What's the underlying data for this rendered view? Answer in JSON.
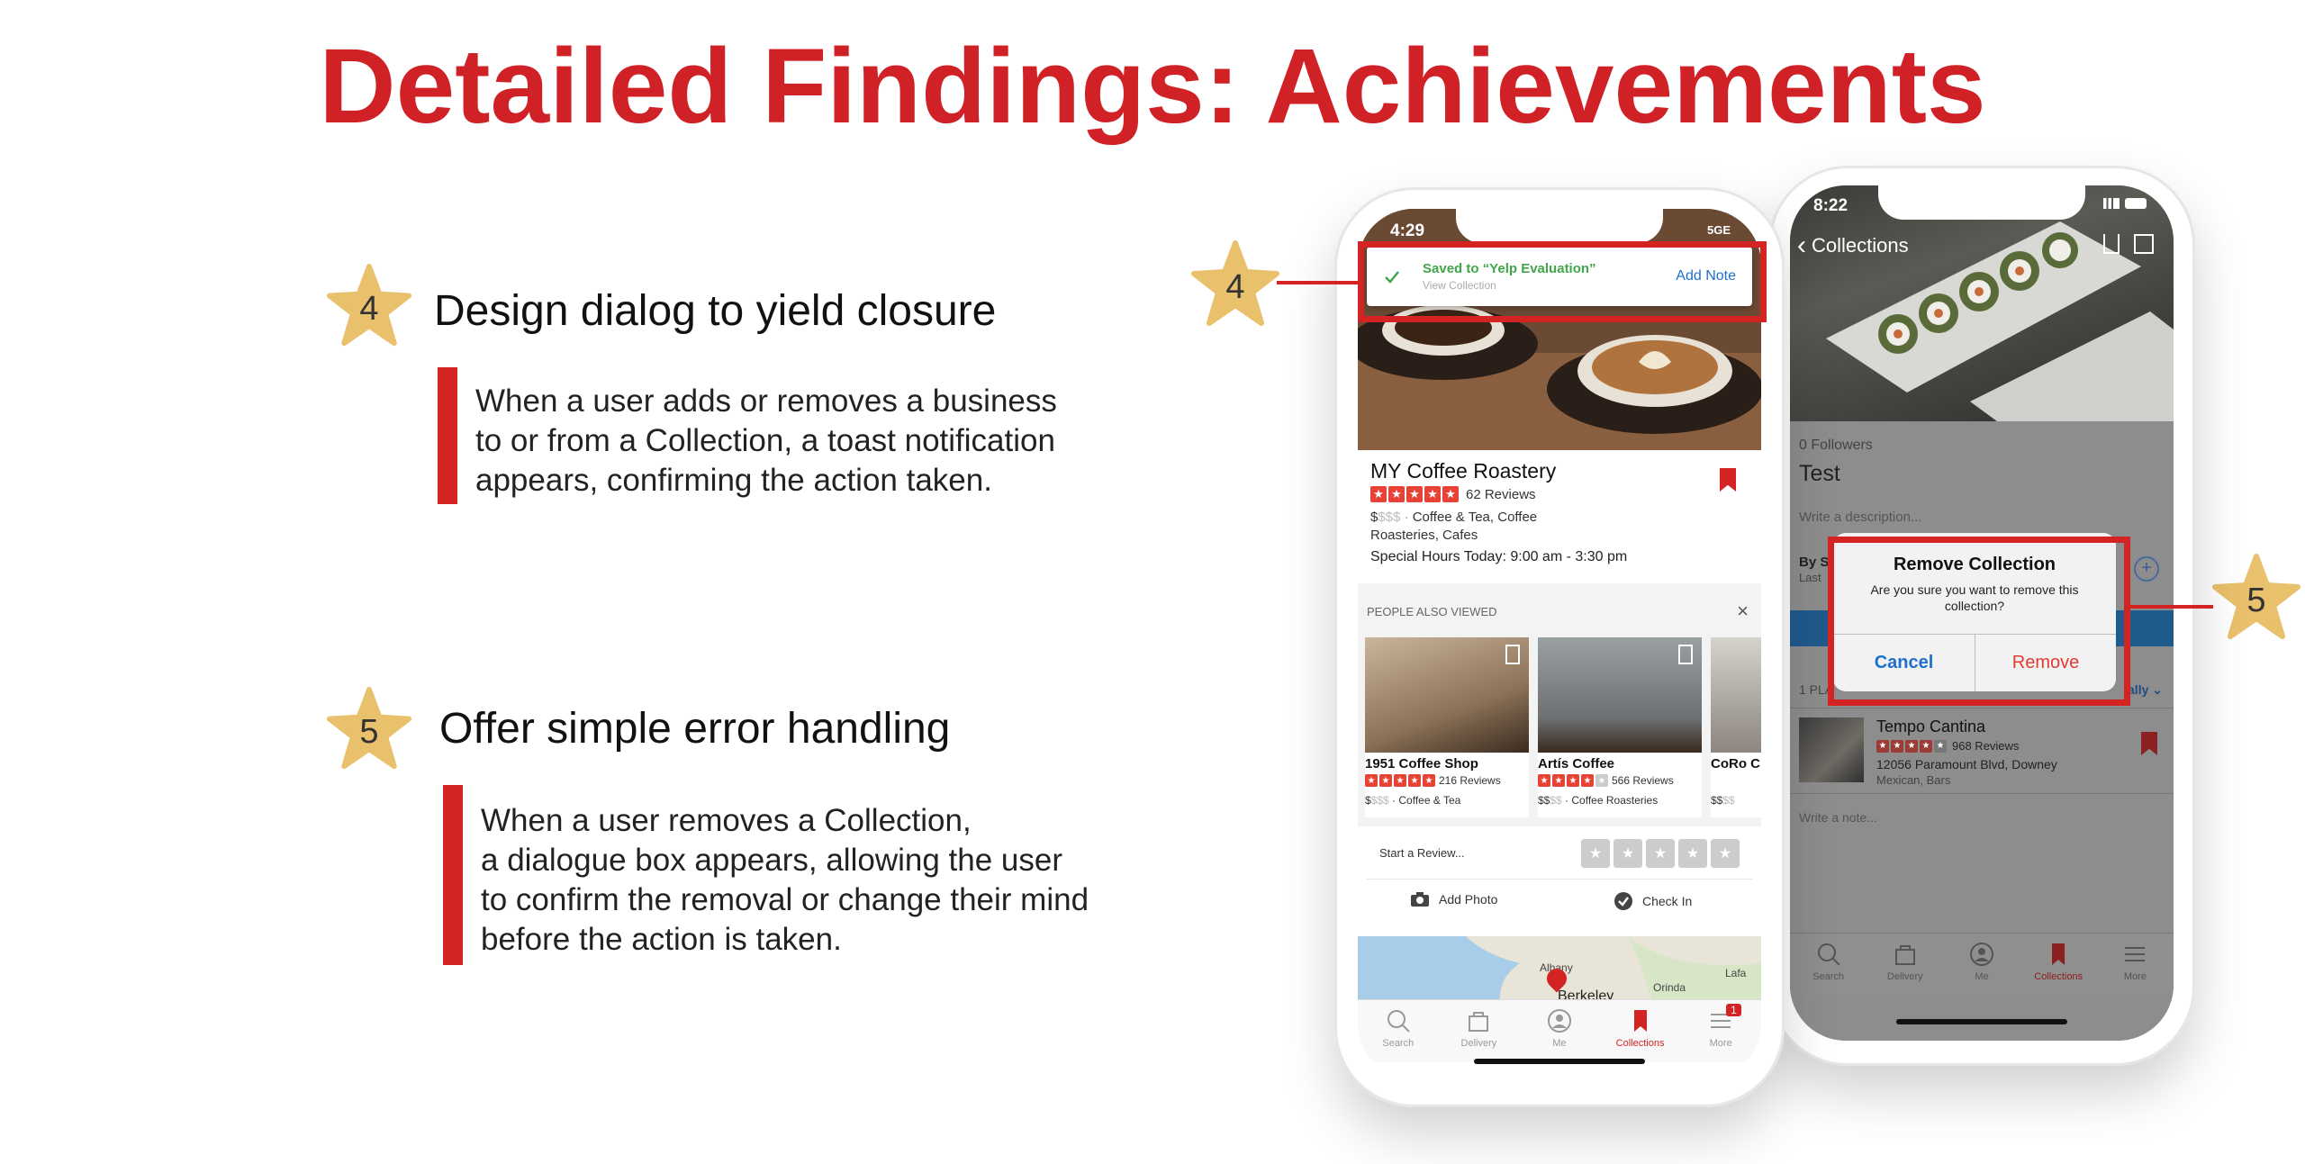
{
  "slide": {
    "title": "Detailed Findings: Achievements",
    "findings": [
      {
        "number": "4",
        "heading": "Design dialog to yield closure",
        "lines": [
          "When a user adds or removes a business",
          "to or from a Collection, a toast notification",
          "appears, confirming the action taken."
        ]
      },
      {
        "number": "5",
        "heading": "Offer simple error handling",
        "lines": [
          "When a user removes a Collection,",
          "a dialogue box appears, allowing the user",
          "to confirm the removal or change their mind",
          "before the action is taken."
        ]
      }
    ],
    "callouts": {
      "left": "4",
      "right": "5"
    },
    "colors": {
      "accent": "#d32323",
      "star": "#e9c06c"
    }
  },
  "phone1": {
    "time": "4:29",
    "network": "5GE",
    "toast": {
      "message": "Saved to “Yelp Evaluation”",
      "sub": "View Collection",
      "action": "Add Note"
    },
    "business": {
      "name": "MY Coffee Roastery",
      "reviews": "62 Reviews",
      "price": "$",
      "price_rest": "$$$",
      "categories": "Coffee & Tea, Coffee",
      "categories2": "Roasteries, Cafes",
      "hours": "Special Hours Today: 9:00 am - 3:30 pm"
    },
    "also_viewed": {
      "header": "PEOPLE ALSO VIEWED",
      "items": [
        {
          "name": "1951 Coffee Shop",
          "reviews": "216 Reviews",
          "price": "$",
          "price_rest": "$$$",
          "category": "Coffee & Tea"
        },
        {
          "name": "Artís Coffee",
          "reviews": "566 Reviews",
          "price": "$$",
          "price_rest": "$$",
          "category": "Coffee Roasteries"
        },
        {
          "name": "CoRo C",
          "reviews": "",
          "price": "$$",
          "price_rest": "$$",
          "category": ""
        }
      ]
    },
    "review_prompt": "Start a Review...",
    "add_photo": "Add Photo",
    "check_in": "Check In",
    "map_labels": [
      "Albany",
      "Berkeley",
      "Orinda",
      "Lafa"
    ],
    "tabs": [
      "Search",
      "Delivery",
      "Me",
      "Collections",
      "More"
    ],
    "more_badge": "1",
    "active_tab": "Collections"
  },
  "phone2": {
    "time": "8:22",
    "back_label": "Collections",
    "followers": "0 Followers",
    "collection_name": "Test",
    "desc_placeholder": "Write a description...",
    "by_label": "By Se",
    "last_label": "Last",
    "places_label": "1 PLA",
    "sort_label": "ally",
    "dialog": {
      "title": "Remove Collection",
      "message": "Are you sure you want to remove this collection?",
      "cancel": "Cancel",
      "confirm": "Remove"
    },
    "place": {
      "name": "Tempo Cantina",
      "reviews": "968 Reviews",
      "address": "12056 Paramount Blvd, Downey",
      "category": "Mexican, Bars"
    },
    "note_placeholder": "Write a note...",
    "tabs": [
      "Search",
      "Delivery",
      "Me",
      "Collections",
      "More"
    ],
    "active_tab": "Collections"
  }
}
